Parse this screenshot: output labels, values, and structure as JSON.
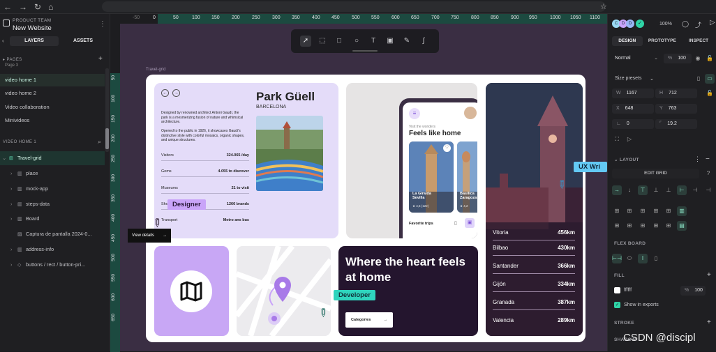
{
  "browser": {
    "back": "←",
    "forward": "→",
    "reload": "↻",
    "home": "⌂",
    "star": "☆"
  },
  "left_panel": {
    "team": "PRODUCT TEAM",
    "project": "New Website",
    "tabs": [
      "LAYERS",
      "ASSETS"
    ],
    "pages_title": "PAGES",
    "pages_partial": "Page 3",
    "pages": [
      "video home 1",
      "video home 2",
      "Video collaboration",
      "Minivideos"
    ],
    "layers_title": "VIDEO HOME 1",
    "layers": [
      {
        "label": "Travel-grid",
        "icon": "grid-icon"
      },
      {
        "label": "place",
        "icon": "board-icon"
      },
      {
        "label": "mock-app",
        "icon": "board-icon"
      },
      {
        "label": "steps-data",
        "icon": "board-icon"
      },
      {
        "label": "Board",
        "icon": "board-icon"
      },
      {
        "label": "Captura de pantalla 2024-0...",
        "icon": "image-icon"
      },
      {
        "label": "address-info",
        "icon": "board-icon"
      },
      {
        "label": "buttons / rect / button-pri...",
        "icon": "component-icon"
      }
    ]
  },
  "ruler_top": [
    "-50",
    "0",
    "50",
    "100",
    "150",
    "200",
    "250",
    "300",
    "350",
    "400",
    "450",
    "500",
    "550",
    "600",
    "650",
    "700",
    "750",
    "800",
    "850",
    "900",
    "950",
    "1000",
    "1050",
    "1100"
  ],
  "ruler_left": [
    "50",
    "100",
    "150",
    "200",
    "250",
    "300",
    "350",
    "400",
    "450",
    "500",
    "550",
    "600",
    "650"
  ],
  "canvas": {
    "board_label": "Travel-grid",
    "park": {
      "title": "Park Güell",
      "city": "BARCELONA",
      "description_1": "Designed by renowned architect Antoni Gaudí, the park is a mesmerizing fusion of nature and whimsical architecture.",
      "description_2": "Opened to the public in 1926, it showcases Gaudí's distinctive style with colorful mosaics, organic shapes, and unique structures.",
      "stats": [
        {
          "k": "Visitors",
          "v": "324.065 /day"
        },
        {
          "k": "Gems",
          "v": "4.055 to discover"
        },
        {
          "k": "Museums",
          "v": "21 to visit"
        },
        {
          "k": "Shops",
          "v": "1266 brands"
        },
        {
          "k": "Transport",
          "v": "Metro ans bus"
        }
      ],
      "view_details": "View details"
    },
    "app": {
      "subtitle": "Visit the wonders",
      "title": "Feels like home",
      "card1_title": "La Giralda Sevilla",
      "card1_rating": "4,5 (122)",
      "card2_title": "Basilica Zaragoza",
      "card2_rating": "4,2",
      "favorites": "Favorite trips"
    },
    "cities": [
      {
        "name": "Vitoria",
        "km": "456km"
      },
      {
        "name": "Bilbao",
        "km": "430km"
      },
      {
        "name": "Santander",
        "km": "366km"
      },
      {
        "name": "Gijón",
        "km": "334km"
      },
      {
        "name": "Granada",
        "km": "387km"
      },
      {
        "name": "Valencia",
        "km": "289km"
      }
    ],
    "hero": {
      "title": "Where the heart feels at home",
      "button": "Categories"
    },
    "tags": {
      "designer": "Designer",
      "developer": "Developer",
      "ux": "UX Wri"
    }
  },
  "right_panel": {
    "zoom": "100%",
    "avatars": [
      "C",
      "D",
      "D"
    ],
    "tabs": [
      "DESIGN",
      "PROTOTYPE",
      "INSPECT"
    ],
    "blend": "Normal",
    "opacity_prefix": "%",
    "opacity": "100",
    "size_presets": "Size presets",
    "w_label": "W",
    "w": "1167",
    "h_label": "H",
    "h": "712",
    "x_label": "X",
    "x": "648",
    "y_label": "Y",
    "y": "763",
    "rotation": "0",
    "radius": "19.2",
    "layout_title": "LAYOUT",
    "edit_grid": "EDIT GRID",
    "flex_title": "FLEX BOARD",
    "fill_title": "FILL",
    "fill_hex": "ffffff",
    "fill_opacity_prefix": "%",
    "fill_opacity": "100",
    "show_exports": "Show in exports",
    "stroke_title": "STROKE",
    "shadow_title": "SHADOW"
  },
  "watermark": "CSDN @discipl",
  "colors": {
    "accent": "#2fd4a6",
    "designer_tag": "#c9a4f9",
    "developer_tag": "#2fd4bd",
    "ux_tag": "#63c9f4",
    "canvas": "#3a2e43",
    "ruler_green": "#1c4a40"
  }
}
